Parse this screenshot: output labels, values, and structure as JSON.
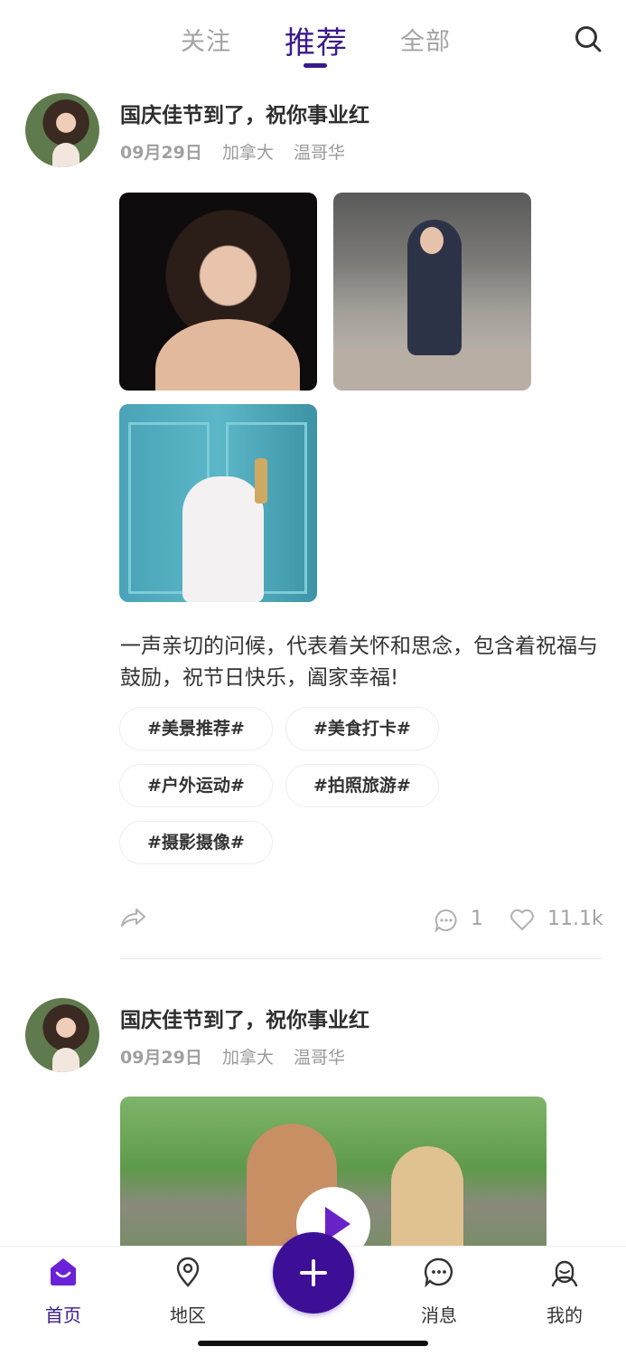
{
  "tabs": [
    {
      "label": "关注",
      "active": false
    },
    {
      "label": "推荐",
      "active": true
    },
    {
      "label": "全部",
      "active": false
    }
  ],
  "search_icon": "search-icon",
  "posts": [
    {
      "title": "国庆佳节到了，祝你事业红",
      "date": "09月29日",
      "country": "加拿大",
      "city": "温哥华",
      "content": "一声亲切的问候，代表着关怀和思念，包含着祝福与鼓励，祝节日快乐，阖家幸福!",
      "tags": [
        "#美景推荐#",
        "#美食打卡#",
        "#户外运动#",
        "#拍照旅游#",
        "#摄影摄像#"
      ],
      "comment_count": "1",
      "like_count": "11.1k"
    },
    {
      "title": "国庆佳节到了，祝你事业红",
      "date": "09月29日",
      "country": "加拿大",
      "city": "温哥华"
    }
  ],
  "nav": {
    "home": "首页",
    "region": "地区",
    "messages": "消息",
    "mine": "我的"
  },
  "colors": {
    "accent": "#3a1a8a",
    "fab": "#3d0f97",
    "muted": "#a3a3a3"
  }
}
